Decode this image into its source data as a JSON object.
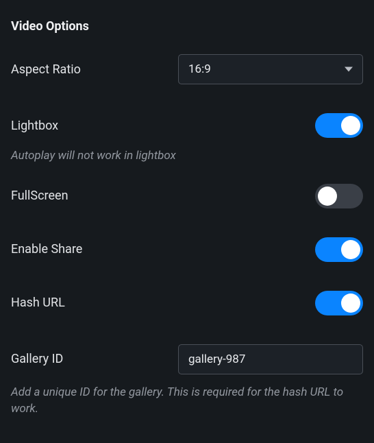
{
  "section_title": "Video Options",
  "aspect_ratio": {
    "label": "Aspect Ratio",
    "value": "16:9"
  },
  "lightbox": {
    "label": "Lightbox",
    "enabled": true,
    "help": "Autoplay will not work in lightbox"
  },
  "fullscreen": {
    "label": "FullScreen",
    "enabled": false
  },
  "enable_share": {
    "label": "Enable Share",
    "enabled": true
  },
  "hash_url": {
    "label": "Hash URL",
    "enabled": true
  },
  "gallery_id": {
    "label": "Gallery ID",
    "value": "gallery-987",
    "help": "Add a unique ID for the gallery. This is required for the hash URL to work."
  }
}
